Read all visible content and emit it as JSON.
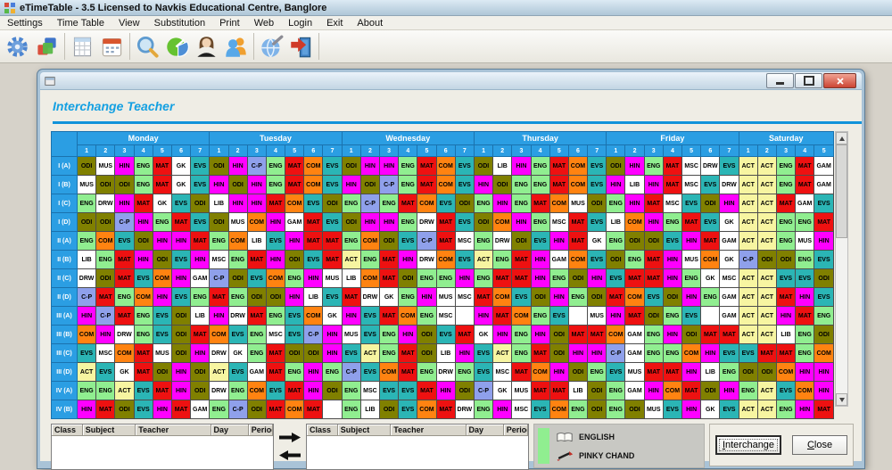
{
  "app": {
    "title": "eTimeTable - 3.5  Licensed to  Navkis Educational Centre, Banglore",
    "menu": [
      "Settings",
      "Time Table",
      "View",
      "Substitution",
      "Print",
      "Web",
      "Login",
      "Exit",
      "About"
    ],
    "toolbar_groups": [
      [
        "settings-gear",
        "timetable-blocks"
      ],
      [
        "report-table",
        "calendar"
      ],
      [
        "search-magnifier",
        "pie-chart",
        "teacher-woman",
        "students-people"
      ],
      [
        "web-publish-globe",
        "exit-door"
      ]
    ]
  },
  "dialog": {
    "title": "Interchange Teacher",
    "window_controls": [
      "minimize",
      "maximize",
      "close"
    ],
    "header_accent_color": "#1092DA",
    "grid_header_color": "#2B9EE3",
    "days": [
      {
        "name": "Monday",
        "periods": [
          "1",
          "2",
          "3",
          "4",
          "5",
          "6",
          "7"
        ]
      },
      {
        "name": "Tuesday",
        "periods": [
          "1",
          "2",
          "3",
          "4",
          "5",
          "6",
          "7"
        ]
      },
      {
        "name": "Wednesday",
        "periods": [
          "1",
          "2",
          "3",
          "4",
          "5",
          "6",
          "7"
        ]
      },
      {
        "name": "Thursday",
        "periods": [
          "1",
          "2",
          "3",
          "4",
          "5",
          "6",
          "7"
        ]
      },
      {
        "name": "Friday",
        "periods": [
          "1",
          "2",
          "3",
          "4",
          "5",
          "6",
          "7"
        ]
      },
      {
        "name": "Saturday",
        "periods": [
          "1",
          "2",
          "3",
          "4",
          "5"
        ]
      }
    ],
    "subject_colors": {
      "ODI": "#808000",
      "HIN": "#FF00FF",
      "ENG": "#90EE90",
      "MAT": "#EE1111",
      "EVS": "#2BB5B5",
      "COM": "#FF8311",
      "C-P": "#8FA0EB",
      "ACT": "#F7F5A1",
      "MUS": "#FFFFFF",
      "GK": "#FFFFFF",
      "LIB": "#FFFFFF",
      "DRW": "#FFFFFF",
      "GAM": "#FFFFFF",
      "MSC": "#FFFFFF",
      "": "#FFFFFF"
    },
    "rows": [
      {
        "label": "I (A)",
        "cells": [
          "ODI",
          "MUS",
          "HIN",
          "ENG",
          "MAT",
          "GK",
          "EVS",
          "ODI",
          "HIN",
          "C-P",
          "ENG",
          "MAT",
          "COM",
          "EVS",
          "ODI",
          "HIN",
          "HIN",
          "ENG",
          "MAT",
          "COM",
          "EVS",
          "ODI",
          "LIB",
          "HIN",
          "ENG",
          "MAT",
          "COM",
          "EVS",
          "ODI",
          "HIN",
          "ENG",
          "MAT",
          "MSC",
          "DRW",
          "EVS",
          "ACT",
          "ACT",
          "ENG",
          "MAT",
          "GAM"
        ]
      },
      {
        "label": "I (B)",
        "cells": [
          "MUS",
          "ODI",
          "ODI",
          "ENG",
          "MAT",
          "GK",
          "EVS",
          "HIN",
          "ODI",
          "HIN",
          "ENG",
          "MAT",
          "COM",
          "EVS",
          "HIN",
          "ODI",
          "C-P",
          "ENG",
          "MAT",
          "COM",
          "EVS",
          "HIN",
          "ODI",
          "ENG",
          "ENG",
          "MAT",
          "COM",
          "EVS",
          "HIN",
          "LIB",
          "HIN",
          "MAT",
          "MSC",
          "EVS",
          "DRW",
          "ACT",
          "ACT",
          "ENG",
          "MAT",
          "GAM"
        ]
      },
      {
        "label": "I (C)",
        "cells": [
          "ENG",
          "DRW",
          "HIN",
          "MAT",
          "GK",
          "EVS",
          "ODI",
          "LIB",
          "HIN",
          "HIN",
          "MAT",
          "COM",
          "EVS",
          "ODI",
          "ENG",
          "C-P",
          "ENG",
          "MAT",
          "COM",
          "EVS",
          "ODI",
          "ENG",
          "HIN",
          "ENG",
          "MAT",
          "COM",
          "MUS",
          "ODI",
          "ENG",
          "HIN",
          "MAT",
          "MSC",
          "EVS",
          "ODI",
          "HIN",
          "ACT",
          "ACT",
          "MAT",
          "GAM",
          "EVS"
        ]
      },
      {
        "label": "I (D)",
        "cells": [
          "ODI",
          "ODI",
          "C-P",
          "HIN",
          "ENG",
          "MAT",
          "EVS",
          "ODI",
          "MUS",
          "COM",
          "HIN",
          "GAM",
          "MAT",
          "EVS",
          "ODI",
          "HIN",
          "HIN",
          "ENG",
          "DRW",
          "MAT",
          "EVS",
          "ODI",
          "COM",
          "HIN",
          "ENG",
          "MSC",
          "MAT",
          "EVS",
          "LIB",
          "COM",
          "HIN",
          "ENG",
          "MAT",
          "EVS",
          "GK",
          "ACT",
          "ACT",
          "ENG",
          "ENG",
          "MAT"
        ]
      },
      {
        "label": "II (A)",
        "cells": [
          "ENG",
          "COM",
          "EVS",
          "ODI",
          "HIN",
          "HIN",
          "MAT",
          "ENG",
          "COM",
          "LIB",
          "EVS",
          "HIN",
          "MAT",
          "MAT",
          "ENG",
          "COM",
          "ODI",
          "EVS",
          "C-P",
          "MAT",
          "MSC",
          "ENG",
          "DRW",
          "ODI",
          "EVS",
          "HIN",
          "MAT",
          "GK",
          "ENG",
          "ODI",
          "ODI",
          "EVS",
          "HIN",
          "MAT",
          "GAM",
          "ACT",
          "ACT",
          "ENG",
          "MUS",
          "HIN"
        ]
      },
      {
        "label": "II (B)",
        "cells": [
          "LIB",
          "ENG",
          "MAT",
          "HIN",
          "ODI",
          "EVS",
          "HIN",
          "MSC",
          "ENG",
          "MAT",
          "HIN",
          "ODI",
          "EVS",
          "MAT",
          "ACT",
          "ENG",
          "MAT",
          "HIN",
          "DRW",
          "COM",
          "EVS",
          "ACT",
          "ENG",
          "MAT",
          "HIN",
          "GAM",
          "COM",
          "EVS",
          "ODI",
          "ENG",
          "MAT",
          "HIN",
          "MUS",
          "COM",
          "GK",
          "C-P",
          "ODI",
          "ODI",
          "ENG",
          "EVS"
        ]
      },
      {
        "label": "II (C)",
        "cells": [
          "DRW",
          "ODI",
          "MAT",
          "EVS",
          "COM",
          "HIN",
          "GAM",
          "C-P",
          "ODI",
          "EVS",
          "COM",
          "ENG",
          "HIN",
          "MUS",
          "LIB",
          "COM",
          "MAT",
          "ODI",
          "ENG",
          "ENG",
          "HIN",
          "ENG",
          "MAT",
          "MAT",
          "HIN",
          "ENG",
          "ODI",
          "HIN",
          "EVS",
          "MAT",
          "MAT",
          "HIN",
          "ENG",
          "GK",
          "MSC",
          "ACT",
          "ACT",
          "EVS",
          "EVS",
          "ODI"
        ]
      },
      {
        "label": "II (D)",
        "cells": [
          "C-P",
          "MAT",
          "ENG",
          "COM",
          "HIN",
          "EVS",
          "ENG",
          "MAT",
          "ENG",
          "ODI",
          "ODI",
          "HIN",
          "LIB",
          "EVS",
          "MAT",
          "DRW",
          "GK",
          "ENG",
          "HIN",
          "MUS",
          "MSC",
          "MAT",
          "COM",
          "EVS",
          "ODI",
          "HIN",
          "ENG",
          "ODI",
          "MAT",
          "COM",
          "EVS",
          "ODI",
          "HIN",
          "ENG",
          "GAM",
          "ACT",
          "ACT",
          "MAT",
          "HIN",
          "EVS"
        ]
      },
      {
        "label": "III (A)",
        "cells": [
          "HIN",
          "C-P",
          "MAT",
          "ENG",
          "EVS",
          "ODI",
          "LIB",
          "HIN",
          "DRW",
          "MAT",
          "ENG",
          "EVS",
          "COM",
          "GK",
          "HIN",
          "EVS",
          "MAT",
          "COM",
          "ENG",
          "MSC",
          "",
          "HIN",
          "MAT",
          "COM",
          "ENG",
          "EVS",
          "",
          "MUS",
          "HIN",
          "MAT",
          "ODI",
          "ENG",
          "EVS",
          "",
          "GAM",
          "ACT",
          "ACT",
          "HIN",
          "MAT",
          "ENG"
        ]
      },
      {
        "label": "III (B)",
        "cells": [
          "COM",
          "HIN",
          "DRW",
          "ENG",
          "EVS",
          "ODI",
          "MAT",
          "COM",
          "EVS",
          "ENG",
          "MSC",
          "EVS",
          "C-P",
          "HIN",
          "MUS",
          "EVS",
          "ENG",
          "HIN",
          "ODI",
          "EVS",
          "MAT",
          "GK",
          "HIN",
          "ENG",
          "HIN",
          "ODI",
          "MAT",
          "MAT",
          "COM",
          "GAM",
          "ENG",
          "HIN",
          "ODI",
          "MAT",
          "MAT",
          "ACT",
          "ACT",
          "LIB",
          "ENG",
          "ODI"
        ]
      },
      {
        "label": "III (C)",
        "cells": [
          "EVS",
          "MSC",
          "COM",
          "MAT",
          "MUS",
          "ODI",
          "HIN",
          "DRW",
          "GK",
          "ENG",
          "MAT",
          "ODI",
          "ODI",
          "HIN",
          "EVS",
          "ACT",
          "ENG",
          "MAT",
          "ODI",
          "LIB",
          "HIN",
          "EVS",
          "ACT",
          "ENG",
          "MAT",
          "ODI",
          "HIN",
          "HIN",
          "C-P",
          "GAM",
          "ENG",
          "ENG",
          "COM",
          "HIN",
          "EVS",
          "EVS",
          "MAT",
          "MAT",
          "ENG",
          "COM"
        ]
      },
      {
        "label": "III (D)",
        "cells": [
          "ACT",
          "EVS",
          "GK",
          "MAT",
          "ODI",
          "HIN",
          "ODI",
          "ACT",
          "EVS",
          "GAM",
          "MAT",
          "ENG",
          "HIN",
          "ENG",
          "C-P",
          "EVS",
          "COM",
          "MAT",
          "ENG",
          "DRW",
          "ENG",
          "EVS",
          "MSC",
          "MAT",
          "COM",
          "HIN",
          "ODI",
          "ENG",
          "EVS",
          "MUS",
          "MAT",
          "MAT",
          "HIN",
          "LIB",
          "ENG",
          "ODI",
          "ODI",
          "COM",
          "HIN",
          "HIN"
        ]
      },
      {
        "label": "IV (A)",
        "cells": [
          "ENG",
          "ENG",
          "ACT",
          "EVS",
          "MAT",
          "HIN",
          "ODI",
          "DRW",
          "ENG",
          "COM",
          "EVS",
          "MAT",
          "HIN",
          "ODI",
          "ENG",
          "MSC",
          "EVS",
          "EVS",
          "MAT",
          "HIN",
          "ODI",
          "C-P",
          "GK",
          "MUS",
          "MAT",
          "MAT",
          "LIB",
          "ODI",
          "ENG",
          "GAM",
          "HIN",
          "COM",
          "MAT",
          "ODI",
          "HIN",
          "ENG",
          "ACT",
          "EVS",
          "COM",
          "HIN"
        ]
      },
      {
        "label": "IV (B)",
        "cells": [
          "HIN",
          "MAT",
          "ODI",
          "EVS",
          "HIN",
          "MAT",
          "GAM",
          "ENG",
          "C-P",
          "ODI",
          "MAT",
          "COM",
          "MAT",
          "",
          "ENG",
          "LIB",
          "ODI",
          "EVS",
          "COM",
          "MAT",
          "DRW",
          "ENG",
          "HIN",
          "MSC",
          "EVS",
          "COM",
          "ENG",
          "ODI",
          "ENG",
          "ODI",
          "MUS",
          "EVS",
          "HIN",
          "GK",
          "EVS",
          "ACT",
          "ACT",
          "ENG",
          "HIN",
          "MAT"
        ]
      }
    ],
    "bottom": {
      "table_headers": [
        "Class",
        "Subject",
        "Teacher",
        "Day",
        "Period"
      ],
      "selection": {
        "subject": "ENGLISH",
        "teacher": "PINKY CHAND",
        "highlight_color": "#90EE90"
      },
      "buttons": [
        "Interchange",
        "Close"
      ]
    }
  }
}
